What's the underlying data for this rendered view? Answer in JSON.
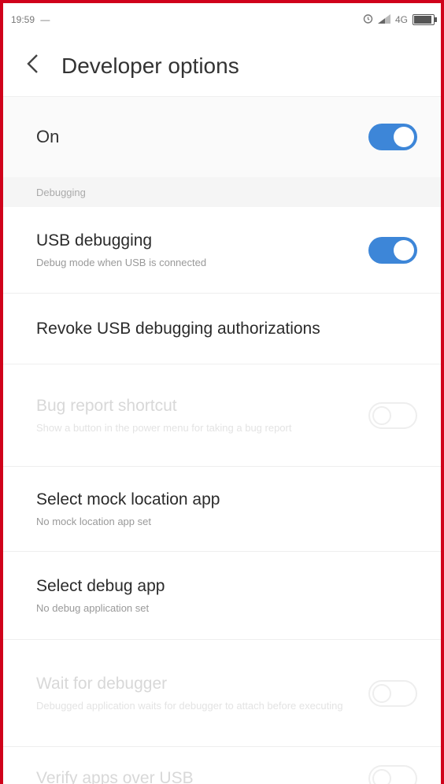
{
  "status_bar": {
    "time": "19:59",
    "notification_glyph": "—",
    "network": "4G",
    "icons": [
      "alarm-icon",
      "signal-icon",
      "battery-icon"
    ]
  },
  "header": {
    "back_icon": "chevron-left-icon",
    "title": "Developer options"
  },
  "master": {
    "label": "On",
    "enabled": true
  },
  "section": {
    "title": "Debugging"
  },
  "items": [
    {
      "title": "USB debugging",
      "subtitle": "Debug mode when USB is connected",
      "toggle": true,
      "enabled": true
    },
    {
      "title": "Revoke USB debugging authorizations",
      "subtitle": "",
      "enabled": true
    },
    {
      "title": "Bug report shortcut",
      "subtitle": "Show a button in the power menu for taking a bug report",
      "toggle": false,
      "enabled": false
    },
    {
      "title": "Select mock location app",
      "subtitle": "No mock location app set",
      "enabled": true
    },
    {
      "title": "Select debug app",
      "subtitle": "No debug application set",
      "enabled": true
    },
    {
      "title": "Wait for debugger",
      "subtitle": "Debugged application waits for debugger to attach before executing",
      "toggle": false,
      "enabled": false
    },
    {
      "title": "Verify apps over USB",
      "subtitle": "",
      "toggle": false,
      "enabled": false
    }
  ],
  "colors": {
    "accent": "#3d86d8",
    "border_highlight": "#d0021b"
  }
}
